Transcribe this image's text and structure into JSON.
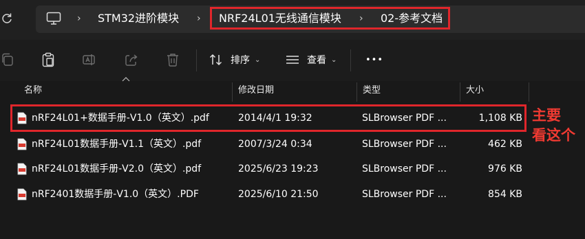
{
  "address_bar": {
    "breadcrumbs": [
      "STM32进阶模块",
      "NRF24L01无线通信模块",
      "02-参考文档"
    ],
    "separator": "›"
  },
  "toolbar": {
    "sort_label": "排序",
    "view_label": "查看",
    "more_label": "•••",
    "icons": [
      "copy-icon",
      "paste-icon",
      "rename-icon",
      "share-icon",
      "delete-icon",
      "sort-icon",
      "view-icon",
      "more-icon"
    ]
  },
  "columns": {
    "name": "名称",
    "modified": "修改日期",
    "type": "类型",
    "size": "大小"
  },
  "files": [
    {
      "name": "nRF24L01+数据手册-V1.0（英文）.pdf",
      "modified": "2014/4/1 19:32",
      "type": "SLBrowser PDF ...",
      "size": "1,108 KB"
    },
    {
      "name": "nRF24L01数据手册-V1.1（英文）.pdf",
      "modified": "2007/3/24 0:34",
      "type": "SLBrowser PDF ...",
      "size": "462 KB"
    },
    {
      "name": "nRF24L01数据手册-V2.0（英文）.pdf",
      "modified": "2025/6/23 19:23",
      "type": "SLBrowser PDF ...",
      "size": "976 KB"
    },
    {
      "name": "nRF2401数据手册-V1.0（英文）.PDF",
      "modified": "2025/6/10 21:50",
      "type": "SLBrowser PDF ...",
      "size": "854 KB"
    }
  ],
  "annotation": {
    "line1": "主要",
    "line2": "看这个",
    "color": "#e0262b"
  }
}
